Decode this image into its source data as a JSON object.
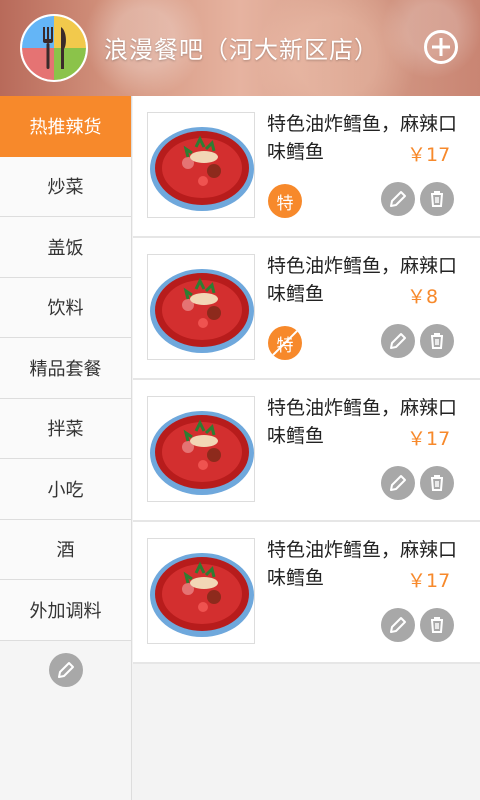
{
  "header": {
    "title": "浪漫餐吧（河大新区店）",
    "logo_icon": "fork-knife-icon",
    "add_icon": "add-circle-icon"
  },
  "sidebar": {
    "items": [
      {
        "label": "热推辣货",
        "active": true
      },
      {
        "label": "炒菜"
      },
      {
        "label": "盖饭"
      },
      {
        "label": "饮料"
      },
      {
        "label": "精品套餐"
      },
      {
        "label": "拌菜"
      },
      {
        "label": "小吃"
      },
      {
        "label": "酒"
      },
      {
        "label": "外加调料"
      }
    ],
    "edit_icon": "pencil-icon"
  },
  "dishes": [
    {
      "name": "特色油炸鳕鱼，麻辣口味鳕鱼",
      "price": "￥17",
      "tag": "特",
      "tag_state": "on"
    },
    {
      "name": "特色油炸鳕鱼，麻辣口味鳕鱼",
      "price": "￥8",
      "tag": "特",
      "tag_state": "off"
    },
    {
      "name": "特色油炸鳕鱼，麻辣口味鳕鱼",
      "price": "￥17"
    },
    {
      "name": "特色油炸鳕鱼，麻辣口味鳕鱼",
      "price": "￥17"
    }
  ],
  "colors": {
    "accent": "#f7892b",
    "button_gray": "#a8a8a8"
  }
}
